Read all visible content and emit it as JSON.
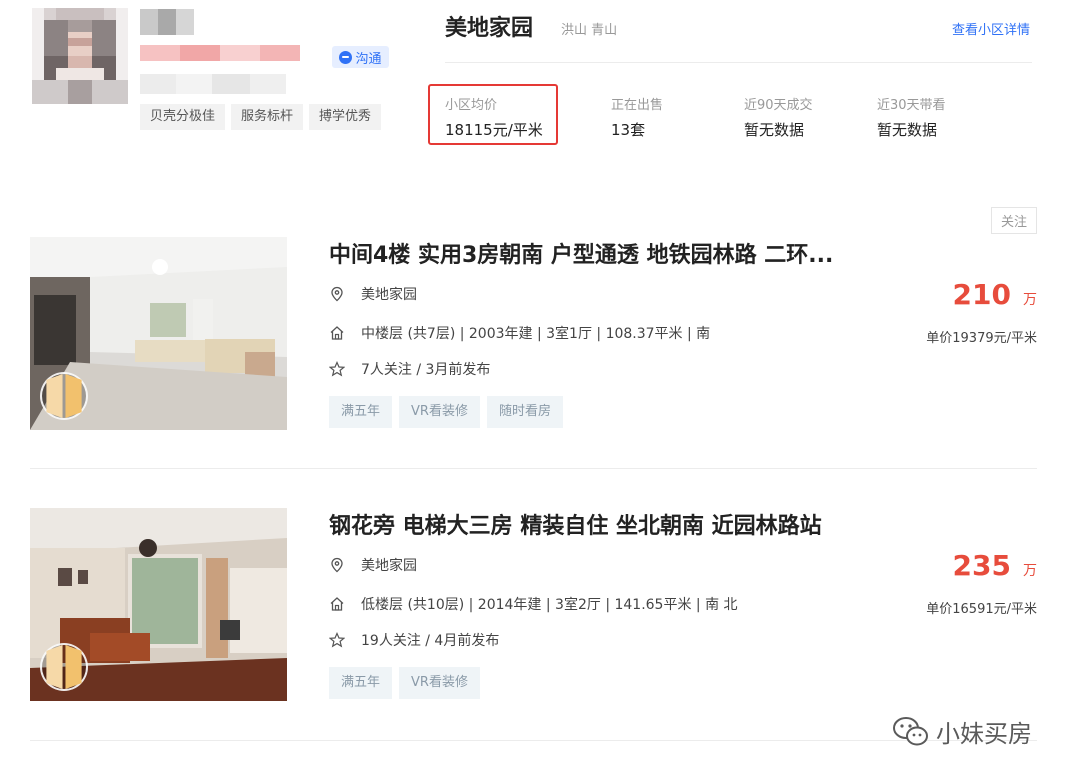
{
  "agent": {
    "chat_label": "沟通",
    "tags": [
      "贝壳分极佳",
      "服务标杆",
      "搏学优秀"
    ]
  },
  "community": {
    "name": "美地家园",
    "location": "洪山 青山",
    "detail_link": "查看小区详情",
    "stats": [
      {
        "label": "小区均价",
        "value": "18115元/平米"
      },
      {
        "label": "正在出售",
        "value": "13套"
      },
      {
        "label": "近90天成交",
        "value": "暂无数据"
      },
      {
        "label": "近30天带看",
        "value": "暂无数据"
      }
    ]
  },
  "follow_label": "关注",
  "listings": [
    {
      "title": "中间4楼 实用3房朝南 户型通透 地铁园林路 二环...",
      "community": "美地家园",
      "info": "中楼层 (共7层) | 2003年建 | 3室1厅 | 108.37平米 | 南",
      "follow": "7人关注 / 3月前发布",
      "tags": [
        "满五年",
        "VR看装修",
        "随时看房"
      ],
      "price": "210",
      "price_unit": "万",
      "unit_price": "单价19379元/平米"
    },
    {
      "title": "钢花旁 电梯大三房 精装自住 坐北朝南 近园林路站",
      "community": "美地家园",
      "info": "低楼层 (共10层) | 2014年建 | 3室2厅 | 141.65平米 | 南 北",
      "follow": "19人关注 / 4月前发布",
      "tags": [
        "满五年",
        "VR看装修"
      ],
      "price": "235",
      "price_unit": "万",
      "unit_price": "单价16591元/平米"
    }
  ],
  "watermark": "小妹买房",
  "icons": [
    "chat-bubble-icon",
    "location-pin-icon",
    "house-icon",
    "star-icon",
    "vr-icon",
    "wechat-icon"
  ],
  "colors": {
    "accent": "#3072f6",
    "price": "#e74c3c",
    "highlight": "#e53935"
  }
}
